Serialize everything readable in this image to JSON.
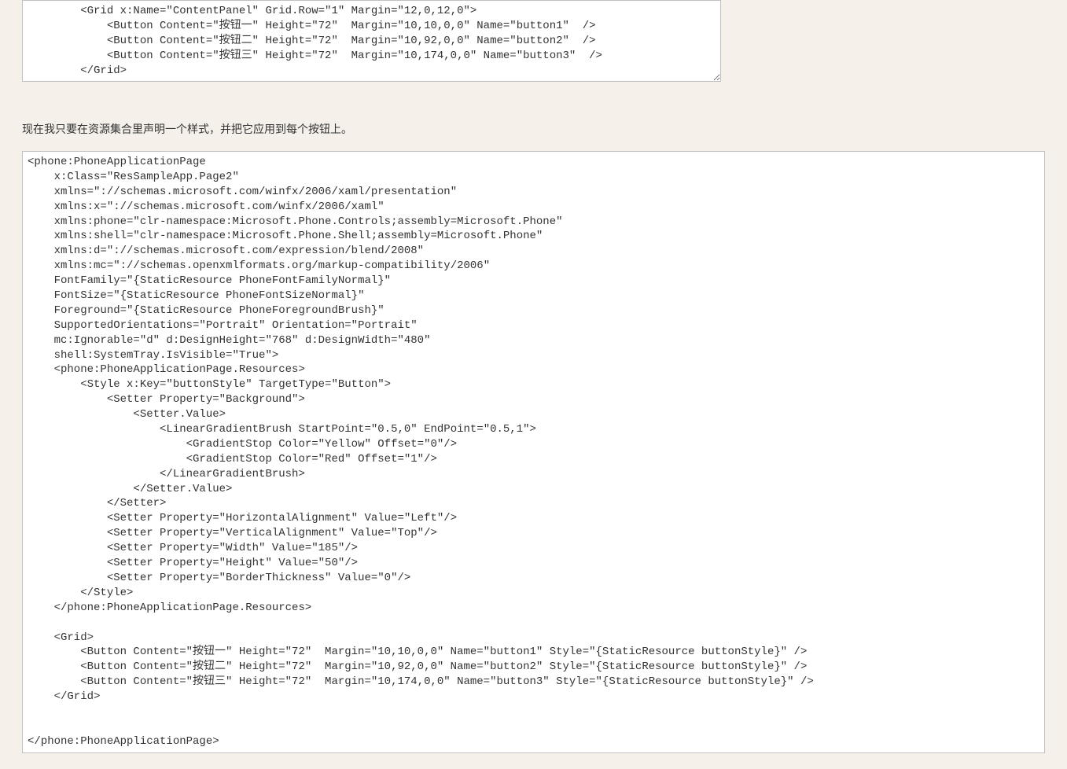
{
  "code_block_1": "        <Grid x:Name=\"ContentPanel\" Grid.Row=\"1\" Margin=\"12,0,12,0\">\n            <Button Content=\"按钮一\" Height=\"72\"  Margin=\"10,10,0,0\" Name=\"button1\"  />\n            <Button Content=\"按钮二\" Height=\"72\"  Margin=\"10,92,0,0\" Name=\"button2\"  />\n            <Button Content=\"按钮三\" Height=\"72\"  Margin=\"10,174,0,0\" Name=\"button3\"  />\n        </Grid>",
  "description_text": "现在我只要在资源集合里声明一个样式，并把它应用到每个按钮上。",
  "code_block_2": "<phone:PhoneApplicationPage \n    x:Class=\"ResSampleApp.Page2\"\n    xmlns=\"://schemas.microsoft.com/winfx/2006/xaml/presentation\"\n    xmlns:x=\"://schemas.microsoft.com/winfx/2006/xaml\"\n    xmlns:phone=\"clr-namespace:Microsoft.Phone.Controls;assembly=Microsoft.Phone\"\n    xmlns:shell=\"clr-namespace:Microsoft.Phone.Shell;assembly=Microsoft.Phone\"\n    xmlns:d=\"://schemas.microsoft.com/expression/blend/2008\"\n    xmlns:mc=\"://schemas.openxmlformats.org/markup-compatibility/2006\"\n    FontFamily=\"{StaticResource PhoneFontFamilyNormal}\"\n    FontSize=\"{StaticResource PhoneFontSizeNormal}\"\n    Foreground=\"{StaticResource PhoneForegroundBrush}\"\n    SupportedOrientations=\"Portrait\" Orientation=\"Portrait\"\n    mc:Ignorable=\"d\" d:DesignHeight=\"768\" d:DesignWidth=\"480\"\n    shell:SystemTray.IsVisible=\"True\">\n    <phone:PhoneApplicationPage.Resources>\n        <Style x:Key=\"buttonStyle\" TargetType=\"Button\">\n            <Setter Property=\"Background\">\n                <Setter.Value>\n                    <LinearGradientBrush StartPoint=\"0.5,0\" EndPoint=\"0.5,1\">\n                        <GradientStop Color=\"Yellow\" Offset=\"0\"/>\n                        <GradientStop Color=\"Red\" Offset=\"1\"/>\n                    </LinearGradientBrush>\n                </Setter.Value>\n            </Setter>\n            <Setter Property=\"HorizontalAlignment\" Value=\"Left\"/>\n            <Setter Property=\"VerticalAlignment\" Value=\"Top\"/>\n            <Setter Property=\"Width\" Value=\"185\"/>\n            <Setter Property=\"Height\" Value=\"50\"/>\n            <Setter Property=\"BorderThickness\" Value=\"0\"/>\n        </Style>\n    </phone:PhoneApplicationPage.Resources>\n\n    <Grid>\n        <Button Content=\"按钮一\" Height=\"72\"  Margin=\"10,10,0,0\" Name=\"button1\" Style=\"{StaticResource buttonStyle}\" />\n        <Button Content=\"按钮二\" Height=\"72\"  Margin=\"10,92,0,0\" Name=\"button2\" Style=\"{StaticResource buttonStyle}\" />\n        <Button Content=\"按钮三\" Height=\"72\"  Margin=\"10,174,0,0\" Name=\"button3\" Style=\"{StaticResource buttonStyle}\" />\n    </Grid>\n\n\n</phone:PhoneApplicationPage>"
}
